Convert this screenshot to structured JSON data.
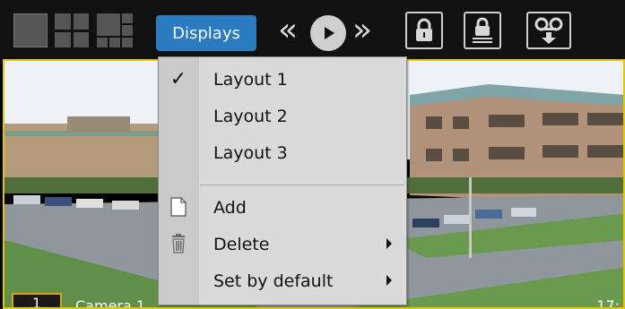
{
  "toolbar": {
    "layout_buttons": [
      {
        "icon": "single-view-icon"
      },
      {
        "icon": "quad-view-icon"
      },
      {
        "icon": "six-view-icon"
      }
    ],
    "displays_label": "Displays",
    "rewind_glyph": "«",
    "forward_glyph": "»",
    "icons": [
      "rewind-icon",
      "play-icon",
      "fast-forward-icon",
      "lock-icon",
      "lock-underline-icon",
      "tape-download-icon"
    ],
    "accent_color": "#2a7bbf"
  },
  "camera": {
    "number": "1",
    "name": "Camera 1",
    "time": "17:"
  },
  "menu": {
    "items": [
      {
        "label": "Layout 1",
        "checked": true
      },
      {
        "label": "Layout 2",
        "checked": false
      },
      {
        "label": "Layout 3",
        "checked": false
      }
    ],
    "actions": [
      {
        "label": "Add",
        "icon": "document-icon",
        "submenu": false
      },
      {
        "label": "Delete",
        "icon": "trash-icon",
        "submenu": true
      },
      {
        "label": "Set by default",
        "icon": "",
        "submenu": true
      }
    ],
    "check_glyph": "✓"
  }
}
